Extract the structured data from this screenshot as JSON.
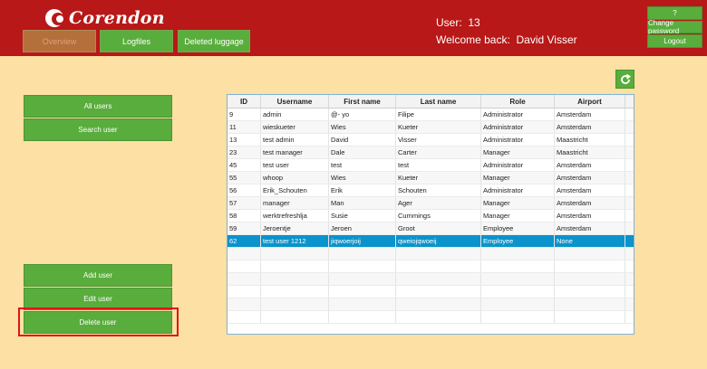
{
  "header": {
    "logo_text": "Corendon",
    "nav": [
      {
        "label": "Overview"
      },
      {
        "label": "Logfiles"
      },
      {
        "label": "Deleted luggage"
      }
    ],
    "user_text": "User:  13",
    "welcome_text": "Welcome back:  David Visser",
    "right_buttons": [
      {
        "label": "?"
      },
      {
        "label": "Change password"
      },
      {
        "label": "Logout"
      }
    ]
  },
  "sidebar": {
    "top_buttons": [
      {
        "label": "All users"
      },
      {
        "label": "Search user"
      }
    ],
    "bottom_buttons": [
      {
        "label": "Add user"
      },
      {
        "label": "Edit user"
      },
      {
        "label": "Delete user"
      }
    ]
  },
  "refresh_icon": "refresh-icon",
  "table": {
    "columns": [
      "ID",
      "Username",
      "First name",
      "Last name",
      "Role",
      "Airport"
    ],
    "rows": [
      [
        "9",
        "admin",
        "@- yo",
        "Filipe",
        "Administrator",
        "Amsterdam"
      ],
      [
        "11",
        "wieskueter",
        "Wies",
        "Kueter",
        "Administrator",
        "Amsterdam"
      ],
      [
        "13",
        "test admin",
        "David",
        "Visser",
        "Administrator",
        "Maastricht"
      ],
      [
        "23",
        "test manager",
        "Dale",
        "Carter",
        "Manager",
        "Maastricht"
      ],
      [
        "45",
        "test user",
        "test",
        "test",
        "Administrator",
        "Amsterdam"
      ],
      [
        "55",
        "whoop",
        "Wies",
        "Kueter",
        "Manager",
        "Amsterdam"
      ],
      [
        "56",
        "Erik_Schouten",
        "Erik",
        "Schouten",
        "Administrator",
        "Amsterdam"
      ],
      [
        "57",
        "manager",
        "Man",
        "Ager",
        "Manager",
        "Amsterdam"
      ],
      [
        "58",
        "werktrefreshlja",
        "Susie",
        "Cummings",
        "Manager",
        "Amsterdam"
      ],
      [
        "59",
        "Jeroentje",
        "Jeroen",
        "Groot",
        "Employee",
        "Amsterdam"
      ],
      [
        "62",
        "test user 1212",
        "jiqwoerjoij",
        "qweiojqwoeij",
        "Employee",
        "None"
      ]
    ],
    "selected_row": 10
  },
  "colors": {
    "header_bg": "#b81817",
    "page_bg": "#fde0a3",
    "button_green": "#59ad3c",
    "selection_blue": "#0a93cc",
    "highlight_red": "#e0141a"
  }
}
